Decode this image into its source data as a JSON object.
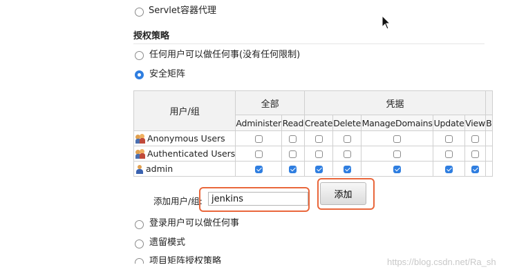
{
  "options_top": {
    "servlet_label": "Servlet容器代理"
  },
  "authorization": {
    "title": "授权策略",
    "options": [
      {
        "label": "任何用户可以做任何事(没有任何限制)",
        "checked": false
      },
      {
        "label": "安全矩阵",
        "checked": true
      },
      {
        "label": "登录用户可以做任何事",
        "checked": false
      },
      {
        "label": "遗留模式",
        "checked": false
      },
      {
        "label": "项目矩阵授权策略",
        "checked": false
      }
    ]
  },
  "matrix": {
    "user_group_header": "用户/组",
    "groups": [
      {
        "name": "全部"
      },
      {
        "name": "凭据"
      }
    ],
    "permissions": [
      "Administer",
      "Read",
      "Create",
      "Delete",
      "ManageDomains",
      "Update",
      "View",
      "B"
    ],
    "rows": [
      {
        "name": "Anonymous Users",
        "icon": "group-icon",
        "checks": [
          false,
          false,
          false,
          false,
          false,
          false,
          false
        ]
      },
      {
        "name": "Authenticated Users",
        "icon": "group-icon",
        "checks": [
          false,
          false,
          false,
          false,
          false,
          false,
          false
        ]
      },
      {
        "name": "admin",
        "icon": "user-icon",
        "checks": [
          true,
          true,
          true,
          true,
          true,
          true,
          true
        ]
      }
    ]
  },
  "add_user": {
    "label": "添加用户/组:",
    "input_value": "jenkins",
    "button_label": "添加"
  },
  "highlight_color": "#e9663a",
  "accent_color": "#2f7ee0",
  "watermark": "https://blog.csdn.net/Ra_sh"
}
